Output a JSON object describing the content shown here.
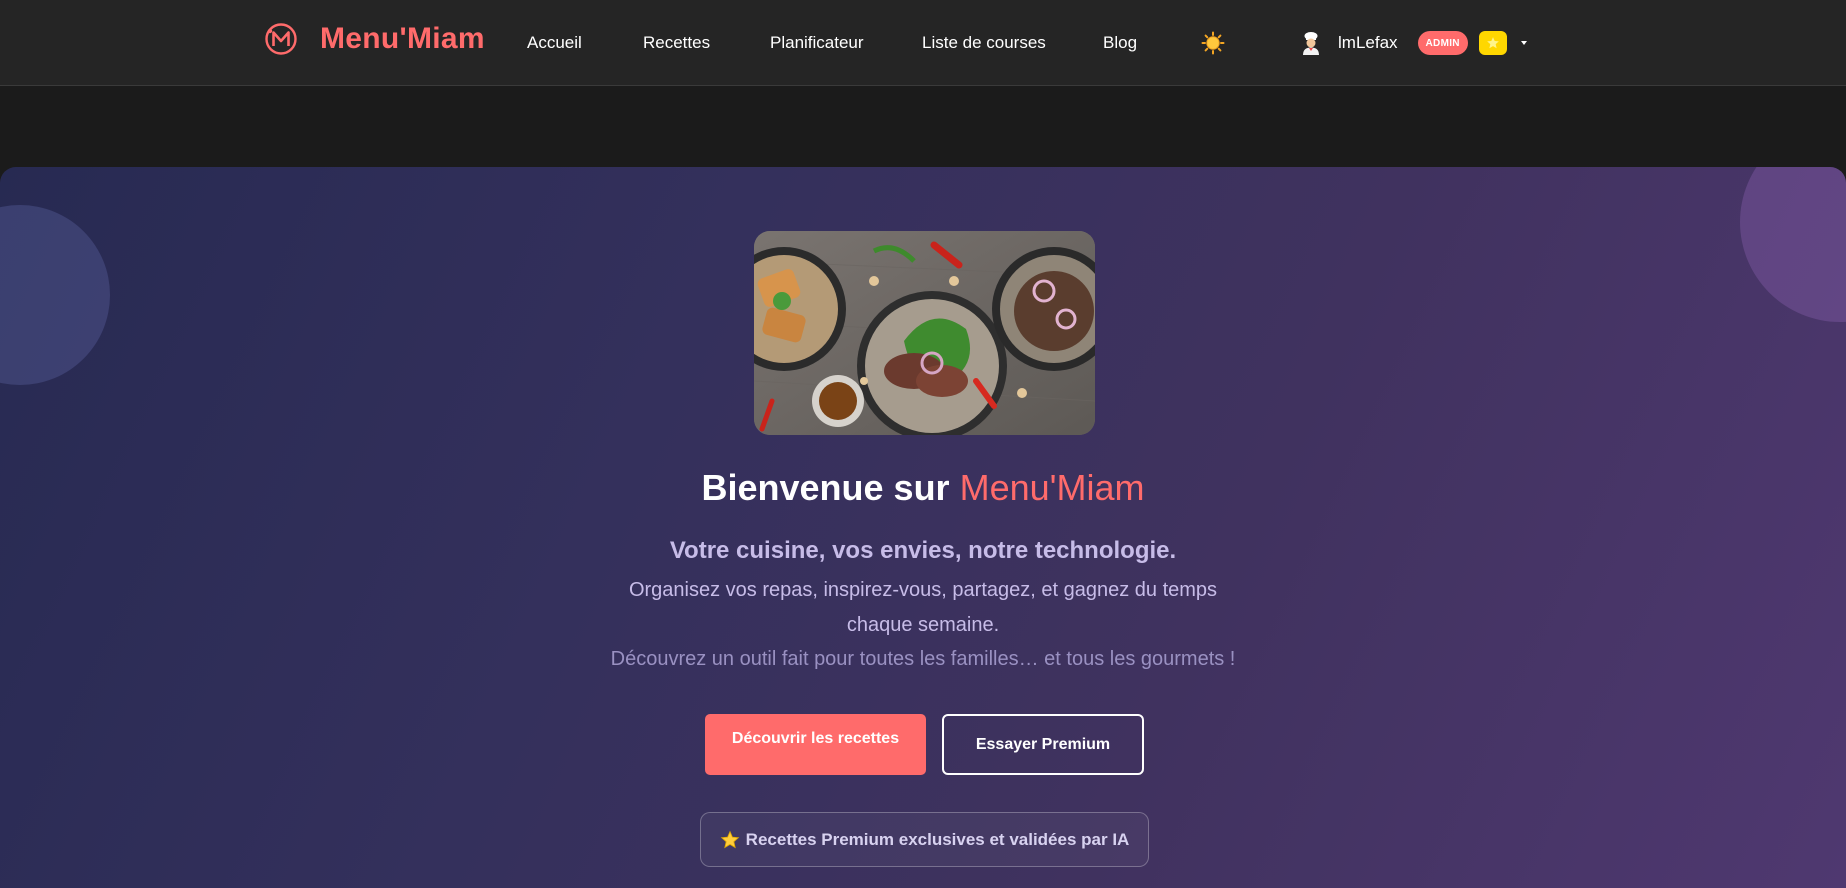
{
  "navbar": {
    "brand": "Menu'Miam",
    "links": [
      "Accueil",
      "Recettes",
      "Planificateur",
      "Liste de courses",
      "Blog"
    ],
    "user": {
      "name": "lmLefax",
      "badge": "ADMIN"
    }
  },
  "hero": {
    "title_prefix": "Bienvenue sur ",
    "title_accent": "Menu'Miam",
    "subtitle": "Votre cuisine, vos envies, notre technologie.",
    "description": "Organisez vos repas, inspirez-vous, partagez, et gagnez du temps chaque semaine.",
    "note": "Découvrez un outil fait pour toutes les familles… et tous les gourmets !",
    "primary_button": "Découvrir les recettes",
    "secondary_button": "Essayer Premium",
    "premium_pill": "Recettes Premium exclusives et validées par IA"
  },
  "colors": {
    "accent": "#ff6b6b",
    "navbar_bg": "#252525",
    "hero_gradient_start": "#272a52",
    "hero_gradient_end": "#4f3870",
    "premium_gold": "#ffd700"
  },
  "icons": {
    "brand": "menumiam-logo-icon",
    "theme_toggle": "sun-icon",
    "user_avatar": "chef-avatar-icon",
    "premium": "star-icon",
    "dropdown": "caret-down-icon"
  }
}
